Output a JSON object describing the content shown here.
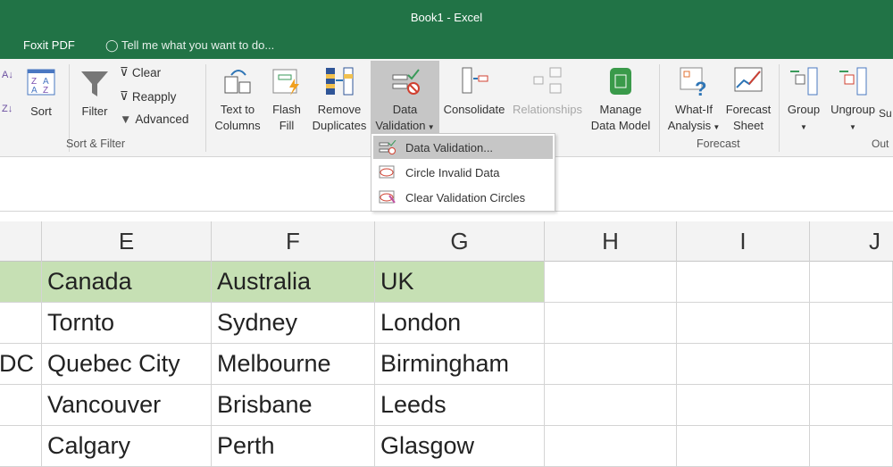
{
  "title": "Book1 - Excel",
  "tabs": {
    "foxit": "Foxit PDF",
    "tell_me": "Tell me what you want to do..."
  },
  "ribbon": {
    "sort": "Sort",
    "filter": "Filter",
    "clear": "Clear",
    "reapply": "Reapply",
    "advanced": "Advanced",
    "sort_filter_group": "Sort & Filter",
    "text_to_columns": [
      "Text to",
      "Columns"
    ],
    "flash_fill": [
      "Flash",
      "Fill"
    ],
    "remove_duplicates": [
      "Remove",
      "Duplicates"
    ],
    "data_validation": [
      "Data",
      "Validation"
    ],
    "consolidate": "Consolidate",
    "relationships": "Relationships",
    "manage_data_model": [
      "Manage",
      "Data Model"
    ],
    "what_if": [
      "What-If",
      "Analysis"
    ],
    "forecast_sheet": [
      "Forecast",
      "Sheet"
    ],
    "forecast_group": "Forecast",
    "group": "Group",
    "ungroup": "Ungroup",
    "subtotal": "Su",
    "outline_group": "Out"
  },
  "menu": [
    "Data Validation...",
    "Circle Invalid Data",
    "Clear Validation Circles"
  ],
  "columns": [
    "E",
    "F",
    "G",
    "H",
    "I",
    "J"
  ],
  "rows": [
    {
      "D": "",
      "E": "Canada",
      "F": "Australia",
      "G": "UK"
    },
    {
      "D": "",
      "E": "Tornto",
      "F": "Sydney",
      "G": "London"
    },
    {
      "D": "DC",
      "E": "Quebec City",
      "F": "Melbourne",
      "G": "Birmingham"
    },
    {
      "D": "",
      "E": "Vancouver",
      "F": "Brisbane",
      "G": "Leeds"
    },
    {
      "D": "",
      "E": "Calgary",
      "F": "Perth",
      "G": "Glasgow"
    }
  ]
}
